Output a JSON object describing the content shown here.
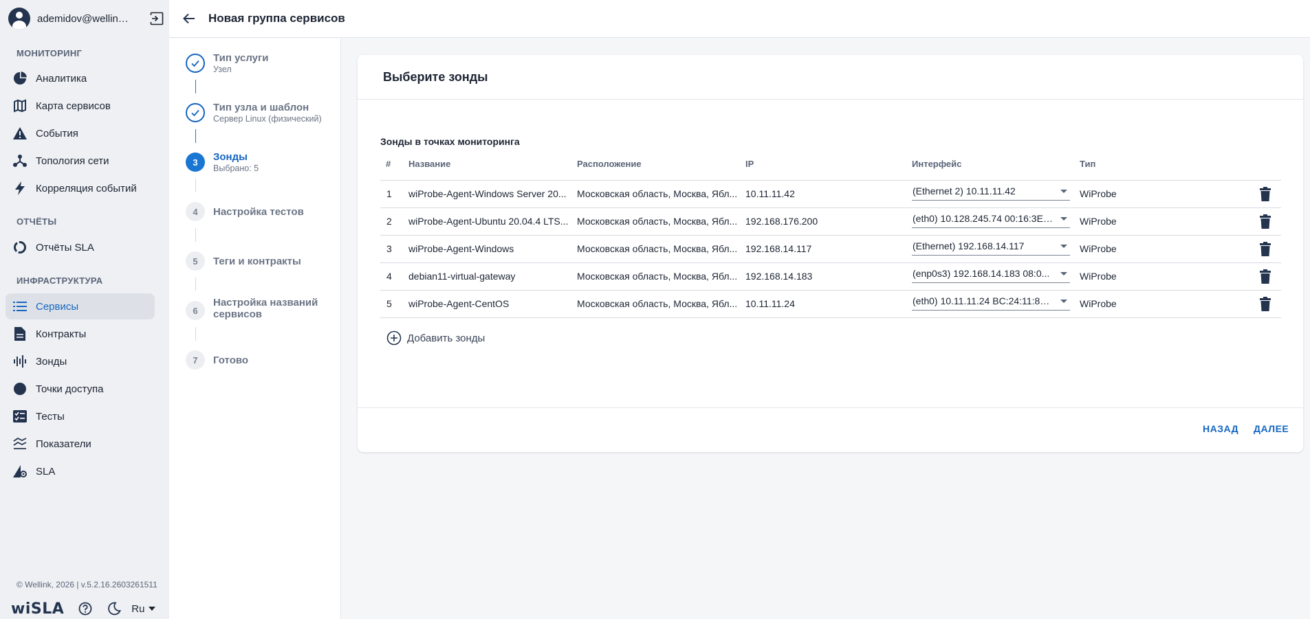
{
  "user": {
    "name": "ademidov@wellink.ru"
  },
  "sidebar": {
    "sections": [
      {
        "title": "МОНИТОРИНГ"
      },
      {
        "title": "ОТЧЁТЫ"
      },
      {
        "title": "ИНФРАСТРУКТУРА"
      }
    ],
    "items": [
      {
        "label": "Аналитика",
        "icon": "pie-chart-icon"
      },
      {
        "label": "Карта сервисов",
        "icon": "map-icon"
      },
      {
        "label": "События",
        "icon": "warning-icon"
      },
      {
        "label": "Топология сети",
        "icon": "topology-icon"
      },
      {
        "label": "Корреляция событий",
        "icon": "bolt-icon"
      },
      {
        "label": "Отчёты SLA",
        "icon": "donut-chart-icon"
      },
      {
        "label": "Сервисы",
        "icon": "list-icon",
        "active": true
      },
      {
        "label": "Контракты",
        "icon": "document-icon"
      },
      {
        "label": "Зонды",
        "icon": "waveform-icon"
      },
      {
        "label": "Точки доступа",
        "icon": "circle-icon"
      },
      {
        "label": "Тесты",
        "icon": "checklist-icon"
      },
      {
        "label": "Показатели",
        "icon": "metrics-icon"
      },
      {
        "label": "SLA",
        "icon": "sla-icon"
      }
    ],
    "copyright": "© Wellink, 2026 | v.5.2.16.2603261511",
    "logo": "wiSLA",
    "language": "Ru"
  },
  "header": {
    "title": "Новая группа сервисов"
  },
  "stepper": {
    "steps": [
      {
        "number": "1",
        "title": "Тип услуги",
        "subtitle": "Узел",
        "state": "done"
      },
      {
        "number": "2",
        "title": "Тип узла и шаблон",
        "subtitle": "Сервер Linux (физический)",
        "state": "done"
      },
      {
        "number": "3",
        "title": "Зонды",
        "subtitle": "Выбрано: 5",
        "state": "current"
      },
      {
        "number": "4",
        "title": "Настройка тестов",
        "subtitle": "",
        "state": "pending"
      },
      {
        "number": "5",
        "title": "Теги и контракты",
        "subtitle": "",
        "state": "pending"
      },
      {
        "number": "6",
        "title": "Настройка названий сервисов",
        "subtitle": "",
        "state": "pending"
      },
      {
        "number": "7",
        "title": "Готово",
        "subtitle": "",
        "state": "pending"
      }
    ]
  },
  "card": {
    "title": "Выберите зонды",
    "table_caption": "Зонды в точках мониторинга",
    "columns": [
      "#",
      "Название",
      "Расположение",
      "IP",
      "Интерфейс",
      "Тип"
    ],
    "rows": [
      {
        "num": "1",
        "name": "wiProbe-Agent-Windows Server 20...",
        "location": "Московская область, Москва, Ябл...",
        "ip": "10.11.11.42",
        "interface": "(Ethernet 2) 10.11.11.42",
        "type": "WiProbe"
      },
      {
        "num": "2",
        "name": "wiProbe-Agent-Ubuntu 20.04.4 LTS...",
        "location": "Московская область, Москва, Ябл...",
        "ip": "192.168.176.200",
        "interface": "(eth0) 10.128.245.74 00:16:3E:...",
        "type": "WiProbe"
      },
      {
        "num": "3",
        "name": "wiProbe-Agent-Windows",
        "location": "Московская область, Москва, Ябл...",
        "ip": "192.168.14.117",
        "interface": "(Ethernet) 192.168.14.117",
        "type": "WiProbe"
      },
      {
        "num": "4",
        "name": "debian11-virtual-gateway",
        "location": "Московская область, Москва, Ябл...",
        "ip": "192.168.14.183",
        "interface": "(enp0s3) 192.168.14.183 08:0...",
        "type": "WiProbe"
      },
      {
        "num": "5",
        "name": "wiProbe-Agent-CentOS",
        "location": "Московская область, Москва, Ябл...",
        "ip": "10.11.11.24",
        "interface": "(eth0) 10.11.11.24 BC:24:11:80:...",
        "type": "WiProbe"
      }
    ],
    "add_label": "Добавить зонды",
    "back_label": "НАЗАД",
    "next_label": "ДАЛЕЕ"
  },
  "colors": {
    "accent": "#1565c0",
    "sidebar_bg": "#eef0f3",
    "active_item_bg": "#dde1e7"
  }
}
